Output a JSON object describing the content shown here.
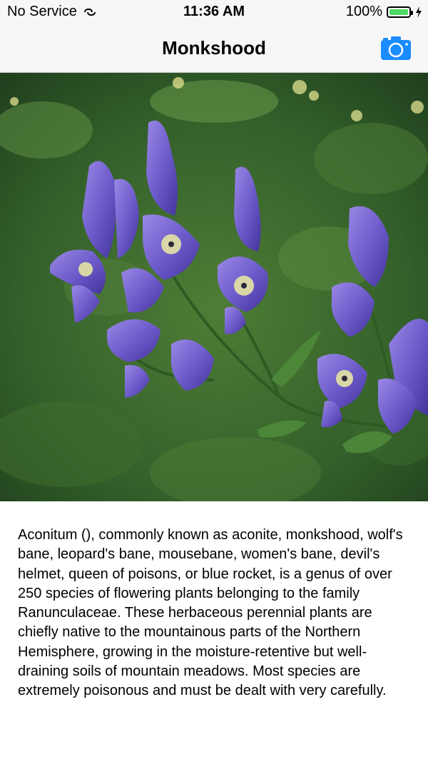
{
  "status_bar": {
    "carrier": "No Service",
    "time": "11:36 AM",
    "battery": "100%",
    "battery_level": 1.0,
    "battery_color": "#4cd964"
  },
  "nav": {
    "title": "Monkshood",
    "camera_icon": "camera-icon",
    "accent_color": "#1a8cff"
  },
  "description": "Aconitum (), commonly known as aconite, monkshood, wolf's bane, leopard's bane, mousebane, women's bane, devil's helmet, queen of poisons, or blue rocket, is a genus of over 250 species of flowering plants belonging to the family Ranunculaceae. These herbaceous perennial plants are chiefly native to the mountainous parts of the Northern Hemisphere, growing in the moisture-retentive but well-draining soils of mountain meadows. Most species are extremely poisonous and must be dealt with very carefully."
}
